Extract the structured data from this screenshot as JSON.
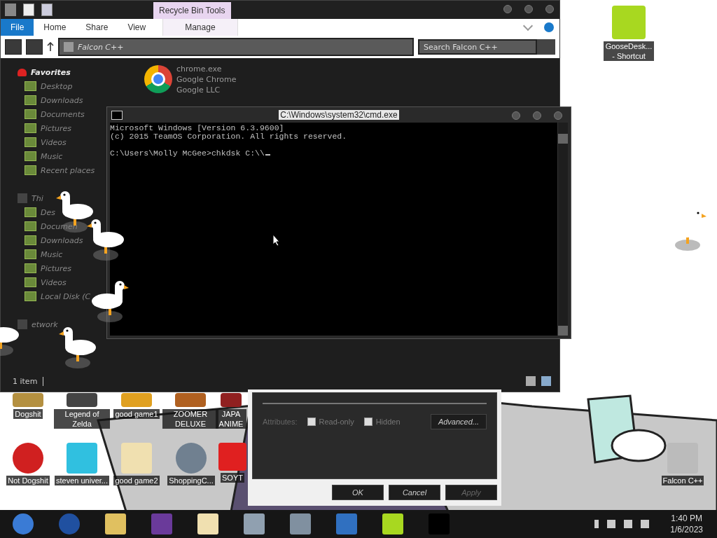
{
  "explorer": {
    "context_tab": "Recycle Bin Tools",
    "ribbon_tabs": [
      {
        "label": "File",
        "kind": "file",
        "selected": false
      },
      {
        "label": "Home",
        "kind": "tab",
        "selected": false
      },
      {
        "label": "Share",
        "kind": "tab",
        "selected": false
      },
      {
        "label": "View",
        "kind": "tab",
        "selected": false
      },
      {
        "label": "Manage",
        "kind": "context",
        "selected": false
      }
    ],
    "address": "Falcon C++",
    "search": {
      "placeholder": "Search Falcon C++"
    },
    "sidebar": {
      "items": [
        {
          "label": "Favorites",
          "children": [
            {
              "label": "Desktop"
            },
            {
              "label": "Downloads"
            },
            {
              "label": "Documents"
            },
            {
              "label": "Pictures"
            },
            {
              "label": "Videos"
            },
            {
              "label": "Music"
            },
            {
              "label": "Recent places"
            }
          ]
        },
        {
          "label": "Thi",
          "children": [
            {
              "label": "Des"
            },
            {
              "label": "Documen"
            },
            {
              "label": "Downloads"
            },
            {
              "label": "Music"
            },
            {
              "label": "Pictures"
            },
            {
              "label": "Videos"
            },
            {
              "label": "Local Disk (C"
            }
          ]
        },
        {
          "label": "etwork"
        }
      ]
    },
    "files": [
      {
        "name": "chrome.exe",
        "description": "Google Chrome",
        "company": "Google LLC"
      }
    ],
    "status": "1 item"
  },
  "console": {
    "title": "C:\\Windows\\system32\\cmd.exe",
    "lines": [
      {
        "text": "Microsoft Windows [Version 6.3.9600]",
        "gap_before": false
      },
      {
        "text": "(c) 2015 TeamOS Corporation. All rights reserved.",
        "gap_before": false
      },
      {
        "text": "C:\\Users\\Molly McGee>chkdsk C:\\\\",
        "gap_before": true
      }
    ]
  },
  "properties": {
    "attributes_label": "Attributes:",
    "checkboxes": [
      {
        "label": "Read-only",
        "checked": false
      },
      {
        "label": "Hidden",
        "checked": false
      }
    ],
    "advanced": "Advanced...",
    "buttons": [
      {
        "label": "OK",
        "disabled": false
      },
      {
        "label": "Cancel",
        "disabled": false
      },
      {
        "label": "Apply",
        "disabled": true
      }
    ]
  },
  "desktop_icons": [
    {
      "label": "Dogshit"
    },
    {
      "label": "Legend of Zelda"
    },
    {
      "label": "good game1"
    },
    {
      "label": "ZOOMER DELUXE"
    },
    {
      "label": "JAPA ANIME"
    },
    {
      "label": "Not Dogshit"
    },
    {
      "label": "steven univer..."
    },
    {
      "label": "good game2"
    },
    {
      "label": "ShoppingC..."
    },
    {
      "label": "SOYT"
    },
    {
      "label": "GooseDesk... - Shortcut"
    },
    {
      "label": "Falcon C++"
    }
  ],
  "taskbar": {
    "time": "1:40 PM",
    "date": "1/6/2023"
  }
}
